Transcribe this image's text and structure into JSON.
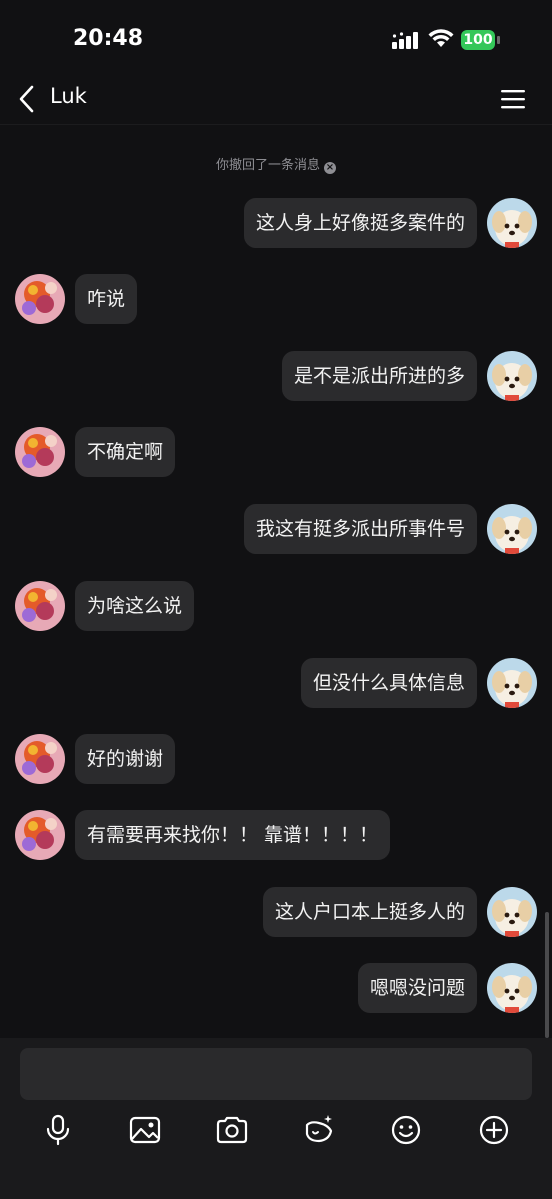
{
  "status_bar": {
    "time": "20:48",
    "battery": "100"
  },
  "header": {
    "title": "Luk"
  },
  "system_note": "你撤回了一条消息",
  "messages": [
    {
      "side": "right",
      "text": "这人身上好像挺多案件的"
    },
    {
      "side": "left",
      "text": "咋说"
    },
    {
      "side": "right",
      "text": "是不是派出所进的多"
    },
    {
      "side": "left",
      "text": "不确定啊"
    },
    {
      "side": "right",
      "text": "我这有挺多派出所事件号"
    },
    {
      "side": "left",
      "text": "为啥这么说"
    },
    {
      "side": "right",
      "text": "但没什么具体信息"
    },
    {
      "side": "left",
      "text": "好的谢谢"
    },
    {
      "side": "left",
      "text": "有需要再来找你！！ 靠谱！！！！"
    },
    {
      "side": "right",
      "text": "这人户口本上挺多人的"
    },
    {
      "side": "right",
      "text": "嗯嗯没问题"
    }
  ],
  "composer": {
    "placeholder": "",
    "tools": [
      "microphone-icon",
      "image-icon",
      "camera-icon",
      "sticker-icon",
      "emoji-icon",
      "plus-icon"
    ]
  },
  "colors": {
    "background": "#111113",
    "bubble": "#2b2b2d",
    "battery": "#34c759"
  }
}
